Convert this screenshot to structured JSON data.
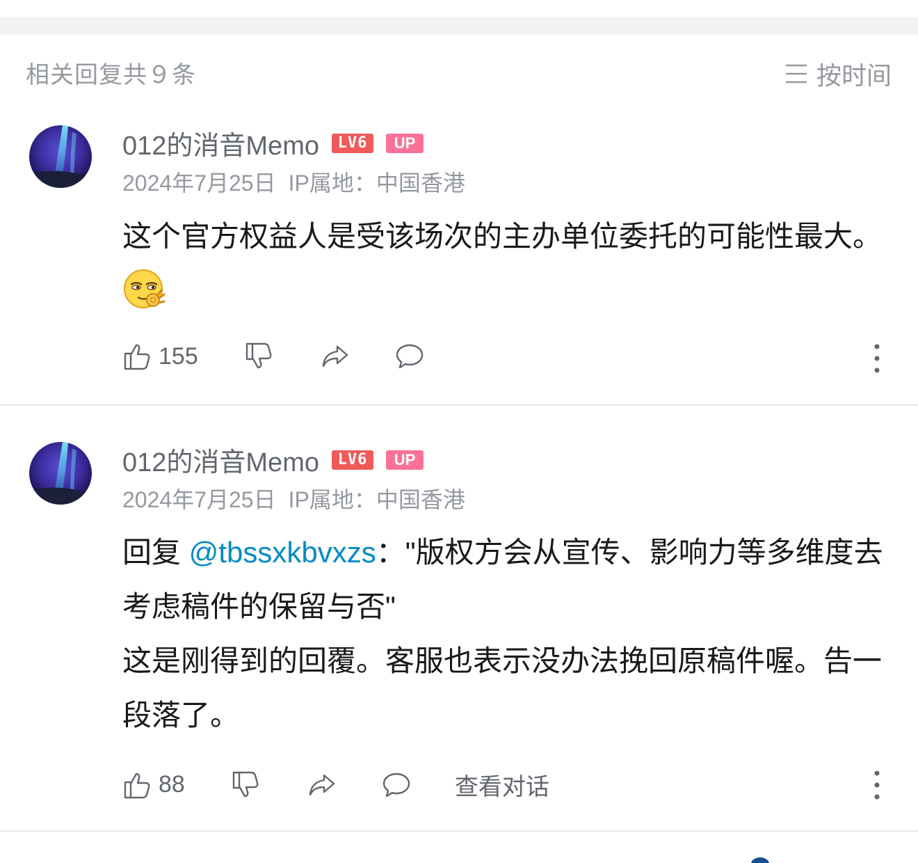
{
  "header": {
    "reply_count": "相关回复共９条",
    "sort_label": "按时间",
    "sort_icon": "list-icon"
  },
  "comments": [
    {
      "username": "012的消音Memo",
      "level_badge": "LV6",
      "up_badge": "UP",
      "date": "2024年7月25日",
      "ip_location": "IP属地：中国香港",
      "content": "这个官方权益人是受该场次的主办单位委托的可能性最大。",
      "emoji": "smirk-ok-emoji",
      "likes": "155"
    },
    {
      "username": "012的消音Memo",
      "level_badge": "LV6",
      "up_badge": "UP",
      "date": "2024年7月25日",
      "ip_location": "IP属地：中国香港",
      "reply_prefix": "回复 ",
      "mention": "@tbssxkbvxzs",
      "content_line1": "：\"版权方会从宣传、影响力等多维度去考虑稿件的保留与否\"",
      "content_line2": "这是刚得到的回覆。客服也表示没办法挽回原稿件喔。告一段落了。",
      "likes": "88",
      "view_conversation": "查看对话"
    }
  ],
  "colors": {
    "mention": "#008ac5",
    "level_badge": "#ef5a5a",
    "up_badge": "#fb7299",
    "meta_text": "#9499a0"
  }
}
